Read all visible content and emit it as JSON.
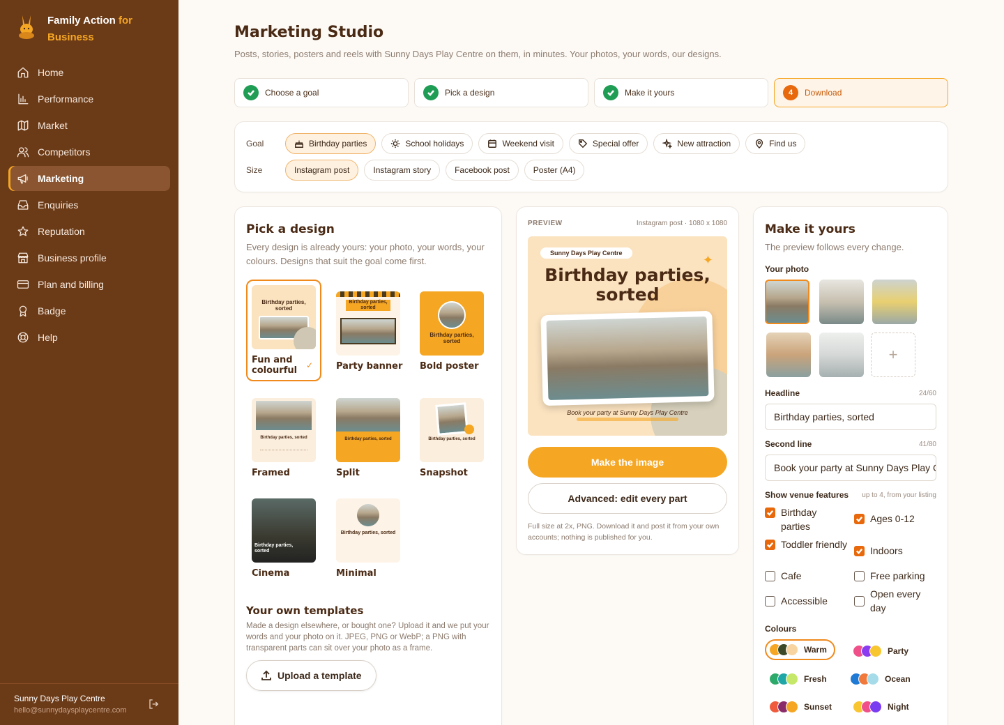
{
  "brand": {
    "name_part1": "Family Action",
    "name_part2": "for",
    "name_part3": "Business"
  },
  "nav": [
    {
      "label": "Home",
      "icon": "home-icon"
    },
    {
      "label": "Performance",
      "icon": "bar-chart-icon"
    },
    {
      "label": "Market",
      "icon": "map-icon"
    },
    {
      "label": "Competitors",
      "icon": "users-icon"
    },
    {
      "label": "Marketing",
      "icon": "megaphone-icon",
      "active": true
    },
    {
      "label": "Enquiries",
      "icon": "inbox-icon"
    },
    {
      "label": "Reputation",
      "icon": "star-icon"
    },
    {
      "label": "Business profile",
      "icon": "store-icon"
    },
    {
      "label": "Plan and billing",
      "icon": "credit-card-icon"
    },
    {
      "label": "Badge",
      "icon": "award-icon"
    },
    {
      "label": "Help",
      "icon": "lifebuoy-icon"
    }
  ],
  "account": {
    "venue": "Sunny Days Play Centre",
    "email": "hello@sunnydaysplaycentre.com"
  },
  "page": {
    "title": "Marketing Studio",
    "subtitle": "Posts, stories, posters and reels with Sunny Days Play Centre on them, in minutes. Your photos, your words, our designs."
  },
  "steps": [
    {
      "label": "Choose a goal",
      "done": true
    },
    {
      "label": "Pick a design",
      "done": true
    },
    {
      "label": "Make it yours",
      "done": true
    },
    {
      "label": "Download",
      "number": "4",
      "current": true
    }
  ],
  "filters": {
    "goal_label": "Goal",
    "size_label": "Size",
    "goals": [
      "Birthday parties",
      "School holidays",
      "Weekend visit",
      "Special offer",
      "New attraction",
      "Find us"
    ],
    "selected_goal": "Birthday parties",
    "sizes": [
      "Instagram post",
      "Instagram story",
      "Facebook post",
      "Poster (A4)"
    ],
    "selected_size": "Instagram post"
  },
  "pick": {
    "title": "Pick a design",
    "description": "Every design is already yours: your photo, your words, your colours. Designs that suit the goal come first.",
    "designs": [
      "Fun and colourful",
      "Party banner",
      "Bold poster",
      "Framed",
      "Split",
      "Snapshot",
      "Cinema",
      "Minimal"
    ],
    "selected_design": "Fun and colourful",
    "own_title": "Your own templates",
    "own_description": "Made a design elsewhere, or bought one? Upload it and we put your words and your photo on it. JPEG, PNG or WebP; a PNG with transparent parts can sit over your photo as a frame.",
    "upload_label": "Upload a template"
  },
  "preview": {
    "label": "PREVIEW",
    "format": "Instagram post · 1080 x 1080",
    "venue_tag": "Sunny Days Play Centre",
    "headline_line1": "Birthday parties,",
    "headline_line2": "sorted",
    "caption": "Book your party at Sunny Days Play Centre",
    "make_label": "Make the image",
    "advanced_label": "Advanced: edit every part",
    "note": "Full size at 2x, PNG. Download it and post it from your own accounts; nothing is published for you."
  },
  "make": {
    "title": "Make it yours",
    "description": "The preview follows every change.",
    "photo_label": "Your photo",
    "headline_label": "Headline",
    "headline_count": "24/60",
    "headline_value": "Birthday parties, sorted",
    "second_label": "Second line",
    "second_count": "41/80",
    "second_value": "Book your party at Sunny Days Play Centre",
    "features_label": "Show venue features",
    "features_hint": "up to 4, from your listing",
    "features": [
      {
        "label": "Birthday parties",
        "checked": true
      },
      {
        "label": "Ages 0-12",
        "checked": true
      },
      {
        "label": "Toddler friendly",
        "checked": true
      },
      {
        "label": "Indoors",
        "checked": true
      },
      {
        "label": "Cafe",
        "checked": false
      },
      {
        "label": "Free parking",
        "checked": false
      },
      {
        "label": "Accessible",
        "checked": false
      },
      {
        "label": "Open every day",
        "checked": false
      }
    ],
    "colours_label": "Colours",
    "palettes": [
      {
        "name": "Warm",
        "colors": [
          "#f5a623",
          "#3d4a2a",
          "#f8d4a0"
        ],
        "selected": true
      },
      {
        "name": "Party",
        "colors": [
          "#f0508a",
          "#8b3cf0",
          "#f8c630"
        ]
      },
      {
        "name": "Fresh",
        "colors": [
          "#2daa6a",
          "#1fa6a6",
          "#c6e86a"
        ]
      },
      {
        "name": "Ocean",
        "colors": [
          "#1f7ad6",
          "#f07a3c",
          "#a6dcea"
        ]
      },
      {
        "name": "Sunset",
        "colors": [
          "#f05a3c",
          "#8a2c6a",
          "#f5a623"
        ]
      },
      {
        "name": "Night",
        "colors": [
          "#f8c630",
          "#f0508a",
          "#7a3cf0"
        ]
      }
    ]
  },
  "colors": {
    "sidebar": "#6b3a17",
    "accent": "#f5a623",
    "accent_dark": "#e8690c",
    "success": "#1f9d55"
  }
}
